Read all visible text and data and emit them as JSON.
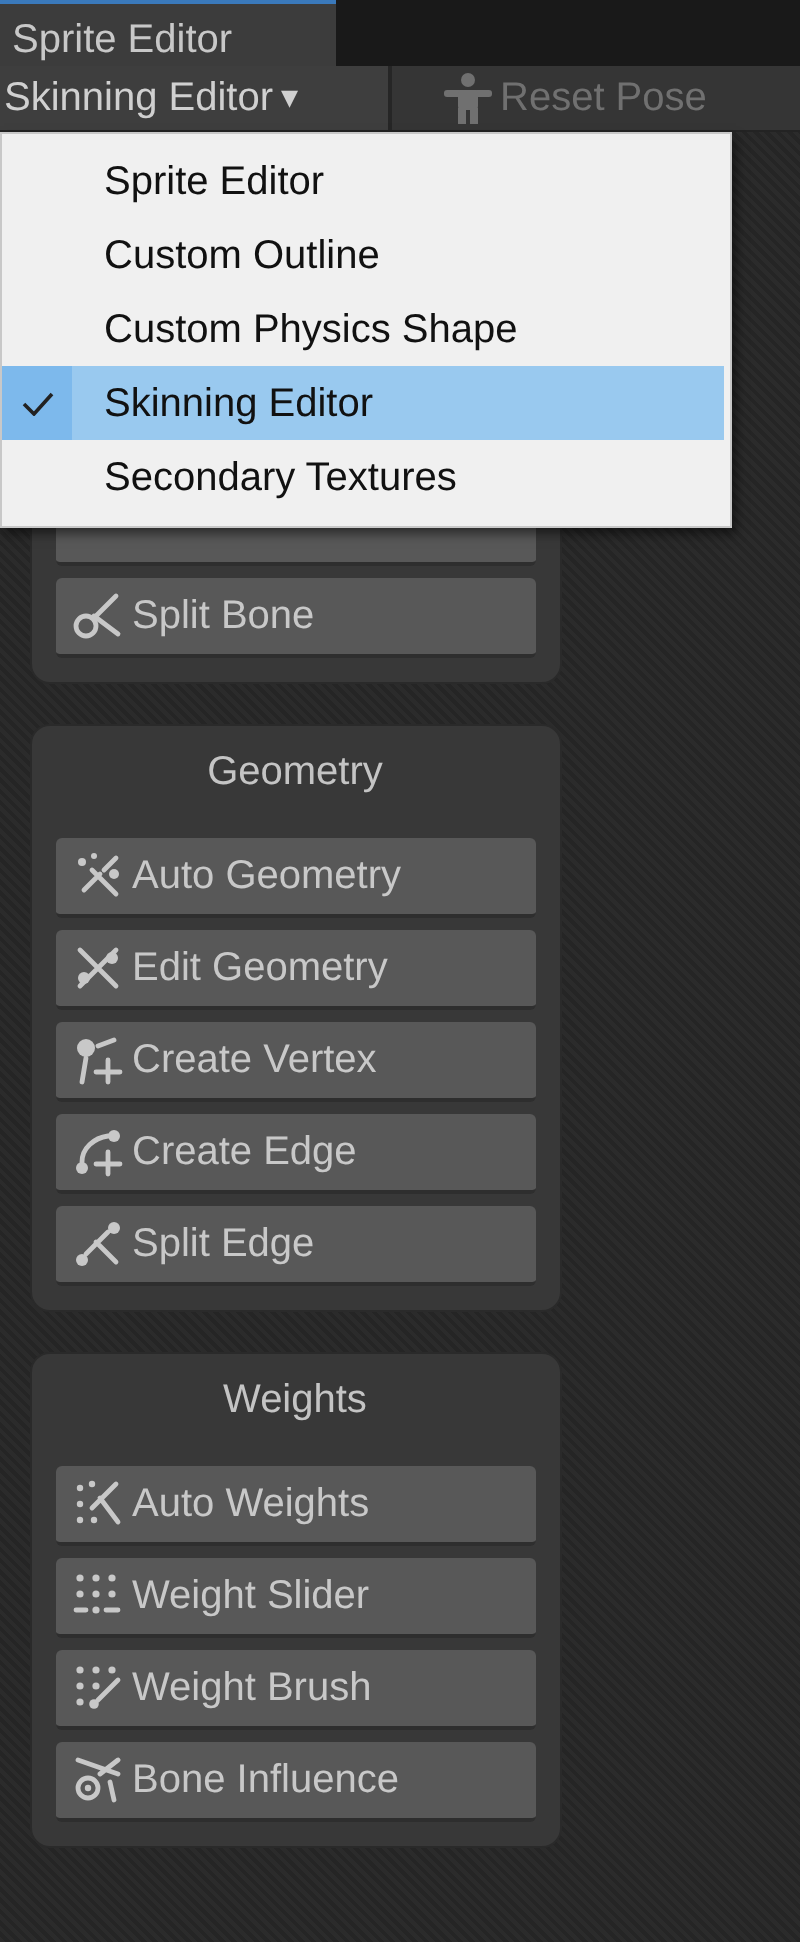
{
  "tabs": [
    {
      "label": "Sprite Editor",
      "selected": true
    }
  ],
  "toolbar": {
    "mode_dropdown": {
      "label": "Skinning Editor",
      "caret": "▾"
    },
    "reset_pose": {
      "label": "Reset Pose",
      "disabled": true
    }
  },
  "mode_menu": {
    "items": [
      {
        "label": "Sprite Editor",
        "checked": false
      },
      {
        "label": "Custom Outline",
        "checked": false
      },
      {
        "label": "Custom Physics Shape",
        "checked": false
      },
      {
        "label": "Skinning Editor",
        "checked": true
      },
      {
        "label": "Secondary Textures",
        "checked": false
      }
    ]
  },
  "panels": [
    {
      "buttons": [
        {
          "kind": "covered"
        },
        "Split Bone"
      ]
    },
    {
      "title": "Geometry",
      "buttons": [
        "Auto Geometry",
        "Edit Geometry",
        "Create Vertex",
        "Create Edge",
        "Split Edge"
      ]
    },
    {
      "title": "Weights",
      "buttons": [
        "Auto Weights",
        "Weight Slider",
        "Weight Brush",
        "Bone Influence"
      ]
    }
  ]
}
